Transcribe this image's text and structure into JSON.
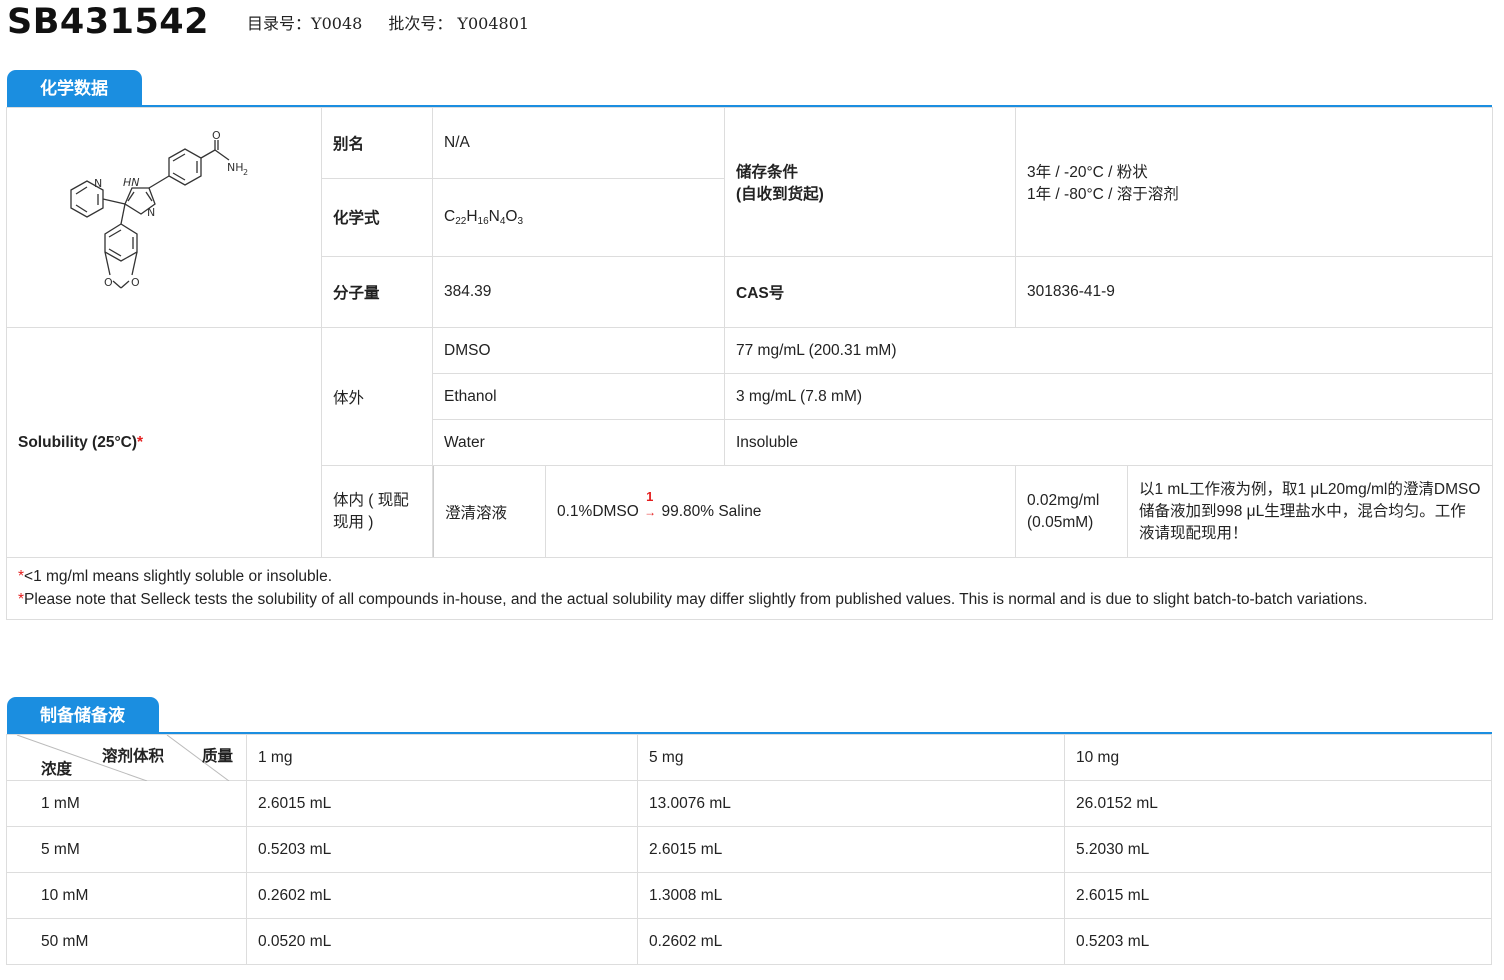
{
  "header": {
    "product_name": "SB431542",
    "catalog_label": "目录号：",
    "catalog_no": "Y0048",
    "batch_label": "批次号：",
    "batch_no": "Y004801"
  },
  "chem_section": {
    "tab": "化学数据",
    "alias_label": "别名",
    "alias": "N/A",
    "formula_label": "化学式",
    "formula": {
      "C": "C",
      "c": "22",
      "H": "H",
      "h": "16",
      "N": "N",
      "n": "4",
      "O": "O",
      "o": "3"
    },
    "mw_label": "分子量",
    "mw": "384.39",
    "storage_label_1": "储存条件",
    "storage_label_2": "(自收到货起)",
    "storage_1": "3年 / -20°C / 粉状",
    "storage_2": "1年 / -80°C / 溶于溶剂",
    "cas_label": "CAS号",
    "cas": "301836-41-9",
    "structure_atoms": {
      "o": "O",
      "nh2": "NH",
      "nh2_sub": "2",
      "hn": "HN",
      "n_pyr": "N",
      "n_im": "N",
      "o1": "O",
      "o2": "O"
    }
  },
  "solubility": {
    "label": "Solubility (25°C)",
    "asterisk": "*",
    "in_vitro_label": "体外",
    "rows": [
      {
        "solvent": "DMSO",
        "value": "77 mg/mL (200.31 mM)"
      },
      {
        "solvent": "Ethanol",
        "value": "3 mg/mL (7.8 mM)"
      },
      {
        "solvent": "Water",
        "value": "Insoluble"
      }
    ],
    "in_vivo_label": "体内 ( 现配现用 )",
    "in_vivo": {
      "type": "澄清溶液",
      "formula_a": "0.1%DMSO",
      "step": "1",
      "formula_b": "99.80% Saline",
      "conc_1": "0.02mg/ml",
      "conc_2": "(0.05mM)",
      "note": "以1 mL工作液为例，取1 μL20mg/ml的澄清DMSO储备液加到998 μL生理盐水中，混合均匀。工作液请现配现用！"
    },
    "notes": [
      {
        "star": "*",
        "text": "<1 mg/ml means slightly soluble or insoluble."
      },
      {
        "star": "*",
        "text": "Please note that Selleck tests the solubility of all compounds in-house, and the actual solubility may differ slightly from published values. This is normal and is due to slight batch-to-batch variations."
      }
    ]
  },
  "stock_section": {
    "tab": "制备储备液",
    "corner": {
      "volume": "溶剂体积",
      "mass": "质量",
      "conc": "浓度"
    },
    "mass_headers": [
      "1 mg",
      "5 mg",
      "10 mg"
    ],
    "rows": [
      {
        "conc": "1 mM",
        "values": [
          "2.6015 mL",
          "13.0076 mL",
          "26.0152 mL"
        ]
      },
      {
        "conc": "5 mM",
        "values": [
          "0.5203 mL",
          "2.6015 mL",
          "5.2030 mL"
        ]
      },
      {
        "conc": "10 mM",
        "values": [
          "0.2602 mL",
          "1.3008 mL",
          "2.6015 mL"
        ]
      },
      {
        "conc": "50 mM",
        "values": [
          "0.0520 mL",
          "0.2602 mL",
          "0.5203 mL"
        ]
      }
    ]
  },
  "colors": {
    "accent": "#1b8ee0",
    "star": "#e41e1e",
    "border": "#dddddd"
  }
}
